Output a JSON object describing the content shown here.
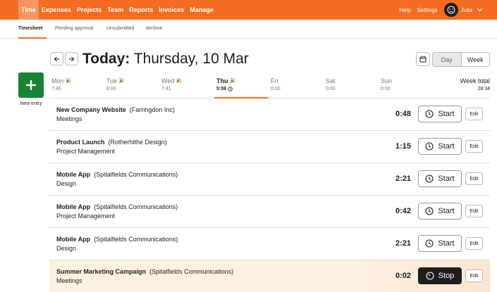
{
  "nav": {
    "items": [
      "Time",
      "Expenses",
      "Projects",
      "Team",
      "Reports",
      "Invoices",
      "Manage"
    ],
    "help": "Help",
    "settings": "Settings",
    "user_name": "Julia",
    "accent": "#f36c21"
  },
  "subnav": {
    "tabs": [
      "Timesheet",
      "Pending approval",
      "Unsubmitted",
      "Archive"
    ]
  },
  "new_entry": {
    "label": "New entry",
    "color": "#188433"
  },
  "header": {
    "today_label": "Today:",
    "date": "Thursday, 10 Mar",
    "view_day": "Day",
    "view_week": "Week"
  },
  "week": {
    "days": [
      {
        "name": "Mon",
        "time": "7:45"
      },
      {
        "name": "Tue",
        "time": "8:00"
      },
      {
        "name": "Wed",
        "time": "7:41"
      },
      {
        "name": "Thu",
        "time": "5:08"
      },
      {
        "name": "Fri",
        "time": "0:00"
      },
      {
        "name": "Sat",
        "time": "0:00"
      },
      {
        "name": "Sun",
        "time": "0:00"
      }
    ],
    "total_label": "Week total",
    "total_value": "28:34"
  },
  "entries": [
    {
      "project": "New Company Website",
      "client": "(Farringdon Inc)",
      "task": "Meetings",
      "duration": "0:48",
      "action": "Start",
      "edit": "Edit"
    },
    {
      "project": "Product Launch",
      "client": "(Rotherhithe Design)",
      "task": "Project Management",
      "duration": "1:15",
      "action": "Start",
      "edit": "Edit"
    },
    {
      "project": "Mobile App",
      "client": "(Spitalfields Communications)",
      "task": "Design",
      "duration": "2:21",
      "action": "Start",
      "edit": "Edit"
    },
    {
      "project": "Mobile App",
      "client": "(Spitalfields Communications)",
      "task": "Project Management",
      "duration": "0:42",
      "action": "Start",
      "edit": "Edit"
    },
    {
      "project": "Mobile App",
      "client": "(Spitalfields Communications)",
      "task": "Design",
      "duration": "2:21",
      "action": "Start",
      "edit": "Edit"
    },
    {
      "project": "Summer Marketing Campaign",
      "client": "(Spitalfields Communications)",
      "task": "Meetings",
      "duration": "0:02",
      "action": "Stop",
      "edit": "Edit"
    }
  ]
}
